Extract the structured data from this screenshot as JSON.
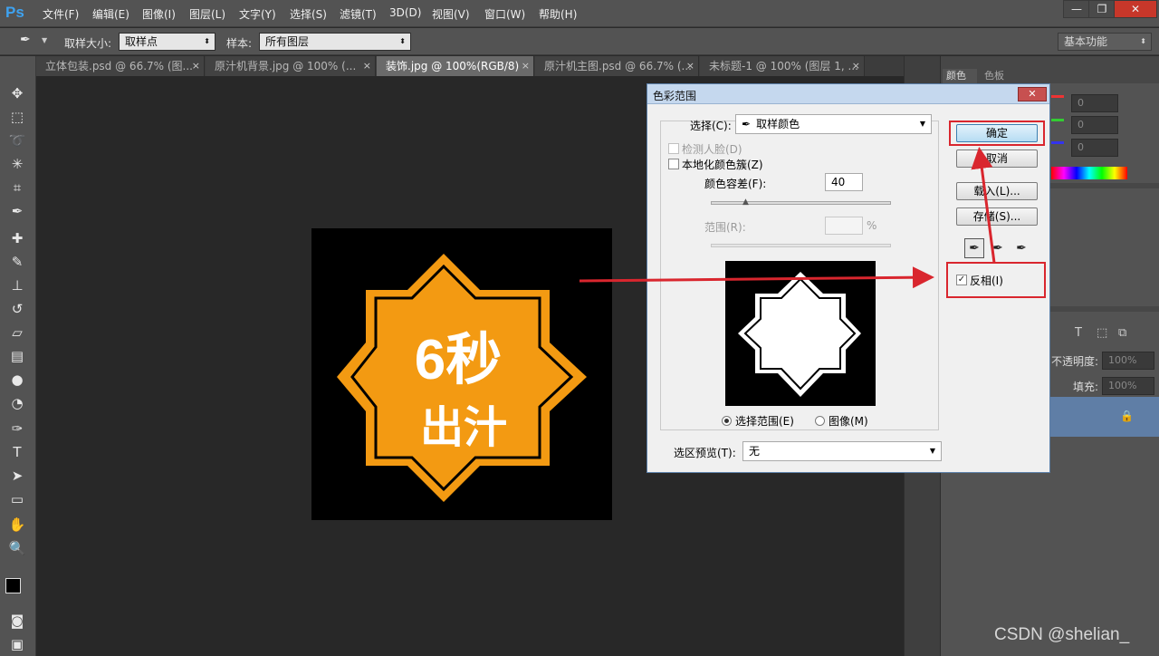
{
  "app": {
    "logo": "Ps"
  },
  "menu": [
    "文件(F)",
    "编辑(E)",
    "图像(I)",
    "图层(L)",
    "文字(Y)",
    "选择(S)",
    "滤镜(T)",
    "3D(D)",
    "视图(V)",
    "窗口(W)",
    "帮助(H)"
  ],
  "window_controls": {
    "minimize": "—",
    "restore": "❐",
    "close": "✕"
  },
  "options": {
    "sample_size_label": "取样大小:",
    "sample_size_value": "取样点",
    "sample_label": "样本:",
    "sample_value": "所有图层",
    "workspace": "基本功能"
  },
  "tabs": [
    {
      "label": "立体包装.psd @ 66.7% (图..."
    },
    {
      "label": "原汁机背景.jpg @ 100% (..."
    },
    {
      "label": "装饰.jpg @ 100%(RGB/8)"
    },
    {
      "label": "原汁机主图.psd @ 66.7% (..."
    },
    {
      "label": "未标题-1 @ 100% (图层 1, ..."
    }
  ],
  "active_tab": 2,
  "tab_close": "×",
  "canvas": {
    "badge_line1": "6秒",
    "badge_line2": "出汁",
    "badge_color": "#f39a12"
  },
  "right_panel": {
    "tab_color": "颜色",
    "tab_swatches": "色板",
    "channel_values": [
      "0",
      "0",
      "0"
    ],
    "opacity_label": "不透明度:",
    "opacity_value": "100%",
    "fill_label": "填充:",
    "fill_value": "100%"
  },
  "dialog": {
    "title": "色彩范围",
    "close": "✕",
    "select_label": "选择(C):",
    "select_value": "取样颜色",
    "detect_faces": "检测人脸(D)",
    "localized_clusters": "本地化颜色簇(Z)",
    "fuzziness_label": "颜色容差(F):",
    "fuzziness_value": "40",
    "range_label": "范围(R):",
    "range_unit": "%",
    "radio_selection": "选择范围(E)",
    "radio_image": "图像(M)",
    "preview_label": "选区预览(T):",
    "preview_value": "无",
    "btn_ok": "确定",
    "btn_cancel": "取消",
    "btn_load": "载入(L)...",
    "btn_save": "存储(S)...",
    "invert_label": "反相(I)",
    "invert_checked": true,
    "check_mark": "✓"
  },
  "watermark": "CSDN @shelian_",
  "colors": {
    "highlight": "#d9262e",
    "ps_bg": "#282828",
    "panel": "#535353"
  }
}
